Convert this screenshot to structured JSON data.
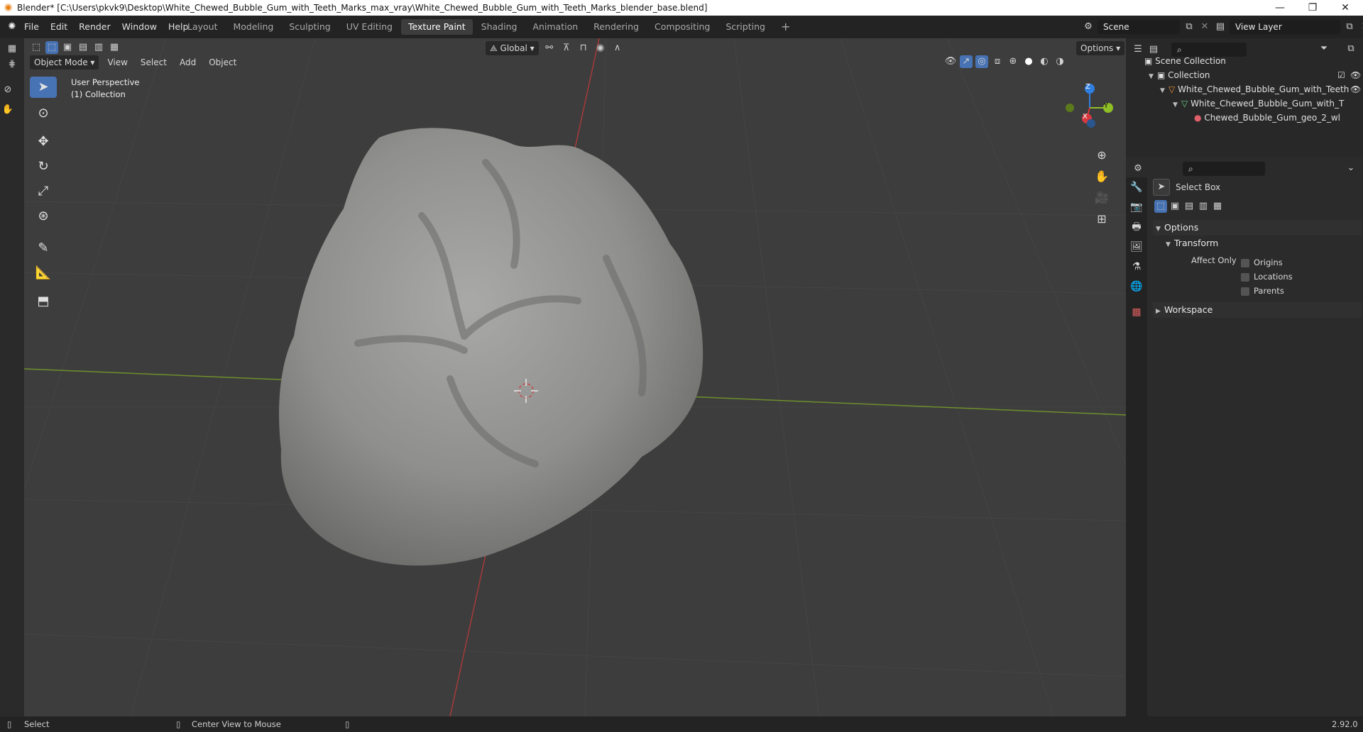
{
  "window": {
    "title": "Blender* [C:\\Users\\pkvk9\\Desktop\\White_Chewed_Bubble_Gum_with_Teeth_Marks_max_vray\\White_Chewed_Bubble_Gum_with_Teeth_Marks_blender_base.blend]"
  },
  "menu": [
    "File",
    "Edit",
    "Render",
    "Window",
    "Help"
  ],
  "workspaces": [
    "Layout",
    "Modeling",
    "Sculpting",
    "UV Editing",
    "Texture Paint",
    "Shading",
    "Animation",
    "Rendering",
    "Compositing",
    "Scripting"
  ],
  "active_workspace": "Texture Paint",
  "scene": {
    "name": "Scene",
    "view_layer": "View Layer"
  },
  "viewport_header": {
    "mode": "Object Mode",
    "menus": [
      "View",
      "Select",
      "Add",
      "Object"
    ],
    "orientation": "Global",
    "options_label": "Options"
  },
  "viewport": {
    "perspective": "User Perspective",
    "collection": "(1) Collection",
    "gizmo": {
      "x": "X",
      "y": "Y",
      "z": "Z"
    }
  },
  "outliner": {
    "root": "Scene Collection",
    "items": [
      {
        "label": "Collection",
        "level": 1
      },
      {
        "label": "White_Chewed_Bubble_Gum_with_Teeth",
        "level": 2
      },
      {
        "label": "White_Chewed_Bubble_Gum_with_T",
        "level": 3
      },
      {
        "label": "Chewed_Bubble_Gum_geo_2_wl",
        "level": 4
      }
    ]
  },
  "properties": {
    "tool_name": "Select Box",
    "options_label": "Options",
    "transform_label": "Transform",
    "affect_only_label": "Affect Only",
    "checkboxes": [
      "Origins",
      "Locations",
      "Parents"
    ],
    "workspace_label": "Workspace"
  },
  "statusbar": {
    "left": "Select",
    "middle": "Center View to Mouse",
    "version": "2.92.0"
  },
  "colors": {
    "accent": "#4772b3",
    "axis_x": "#d7393f",
    "axis_y": "#8fbf27",
    "axis_z": "#2f7ee0"
  }
}
